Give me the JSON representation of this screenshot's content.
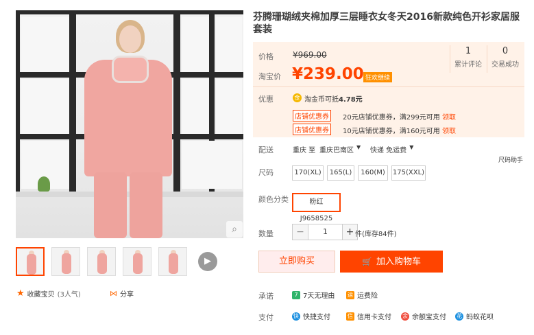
{
  "product": {
    "title": "芬腾珊瑚绒夹棉加厚三层睡衣女冬天2016新款纯色开衫家居服套装"
  },
  "price": {
    "orig_label": "价格",
    "orig_value": "¥969.00",
    "sale_label": "淘宝价",
    "sale_value": "¥239.00",
    "promo_badge": "狂欢继续"
  },
  "stats": [
    {
      "num": "1",
      "label": "累计评论"
    },
    {
      "num": "0",
      "label": "交易成功"
    }
  ],
  "promo": {
    "label": "优惠",
    "coin_icon": "金",
    "coin_text": "淘金币可抵",
    "coin_amount": "4.78元",
    "coupons": [
      {
        "tag": "店铺优惠券",
        "text": "20元店铺优惠券，满299元可用",
        "link": "领取"
      },
      {
        "tag": "店铺优惠券",
        "text": "10元店铺优惠券，满160元可用",
        "link": "领取"
      }
    ]
  },
  "delivery": {
    "label": "配送",
    "from": "重庆 至",
    "to": "重庆巴南区",
    "method": "快递 免运费"
  },
  "size_helper": "尺码助手",
  "size": {
    "label": "尺码",
    "options": [
      "170(XL)",
      "165(L)",
      "160(M)",
      "175(XXL)"
    ]
  },
  "color": {
    "label": "颜色分类",
    "options": [
      "粉红J9658525"
    ]
  },
  "quantity": {
    "label": "数量",
    "minus": "−",
    "value": "1",
    "plus": "+",
    "unit": "件(库存84件)"
  },
  "actions": {
    "buy": "立即购买",
    "cart": "加入购物车"
  },
  "share": {
    "fav": "收藏宝贝",
    "fav_count": "(3人气)",
    "share": "分享"
  },
  "promise": {
    "label": "承诺",
    "items": [
      {
        "icon": "7",
        "text": "7天无理由"
      },
      {
        "icon": "运",
        "text": "运费险"
      }
    ]
  },
  "payment": {
    "label": "支付",
    "items": [
      {
        "icon": "快",
        "text": "快捷支付"
      },
      {
        "icon": "信",
        "text": "信用卡支付"
      },
      {
        "icon": "余",
        "text": "余额宝支付"
      },
      {
        "icon": "花",
        "text": "蚂蚁花呗"
      }
    ]
  },
  "zoom_icon": "⌕",
  "play_icon": "▶",
  "colors": {
    "accent": "#ff4400",
    "price": "#ff4400",
    "pricebox": "#fff2e8"
  }
}
